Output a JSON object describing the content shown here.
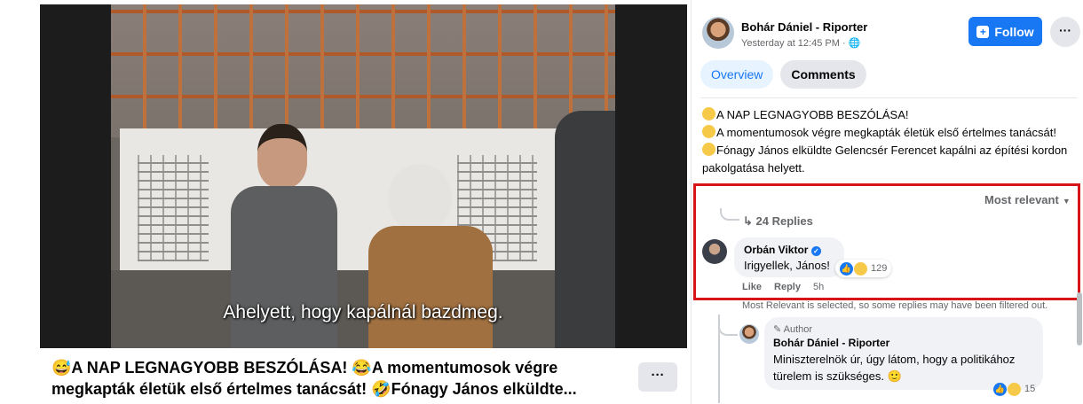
{
  "video": {
    "subtitle": "Ahelyett, hogy kapálnál bazdmeg."
  },
  "post_title": "😅A NAP LEGNAGYOBB BESZÓLÁSA! 😂A momentumosok végre megkapták életük első értelmes tanácsát! 🤣Fónagy János elküldte...",
  "left_more_label": "···",
  "header": {
    "author": "Bohár Dániel - Riporter",
    "meta": "Yesterday at 12:45 PM · 🌐",
    "follow_label": "Follow",
    "follow_icon": "+",
    "more_label": "···"
  },
  "tabs": [
    {
      "label": "Overview",
      "active": true
    },
    {
      "label": "Comments",
      "active": false
    }
  ],
  "post_body": {
    "line1": "A NAP LEGNAGYOBB BESZÓLÁSA!",
    "line2": "A momentumosok végre megkapták életük első értelmes tanácsát!",
    "line3": "Fónagy János elküldte Gelencsér Ferencet kapálni az építési kordon pakolgatása helyett."
  },
  "comments": {
    "sort_label": "Most relevant",
    "replies_label": "↳ 24 Replies",
    "top_comment": {
      "author": "Orbán Viktor",
      "verified_icon": "✓",
      "text": "Irigyellek, János!",
      "reaction_count": "129",
      "like_label": "Like",
      "reply_label": "Reply",
      "time": "5h"
    },
    "filter_note": "Most Relevant is selected, so some replies may have been filtered out.",
    "reply": {
      "badge": "✎ Author",
      "author": "Bohár Dániel - Riporter",
      "text": "Miniszterelnök úr, úgy látom, hogy a politikához türelem is szükséges. 🙂",
      "reaction_count": "15"
    }
  },
  "colors": {
    "accent": "#1877f2",
    "highlight_border": "#d7141a"
  }
}
